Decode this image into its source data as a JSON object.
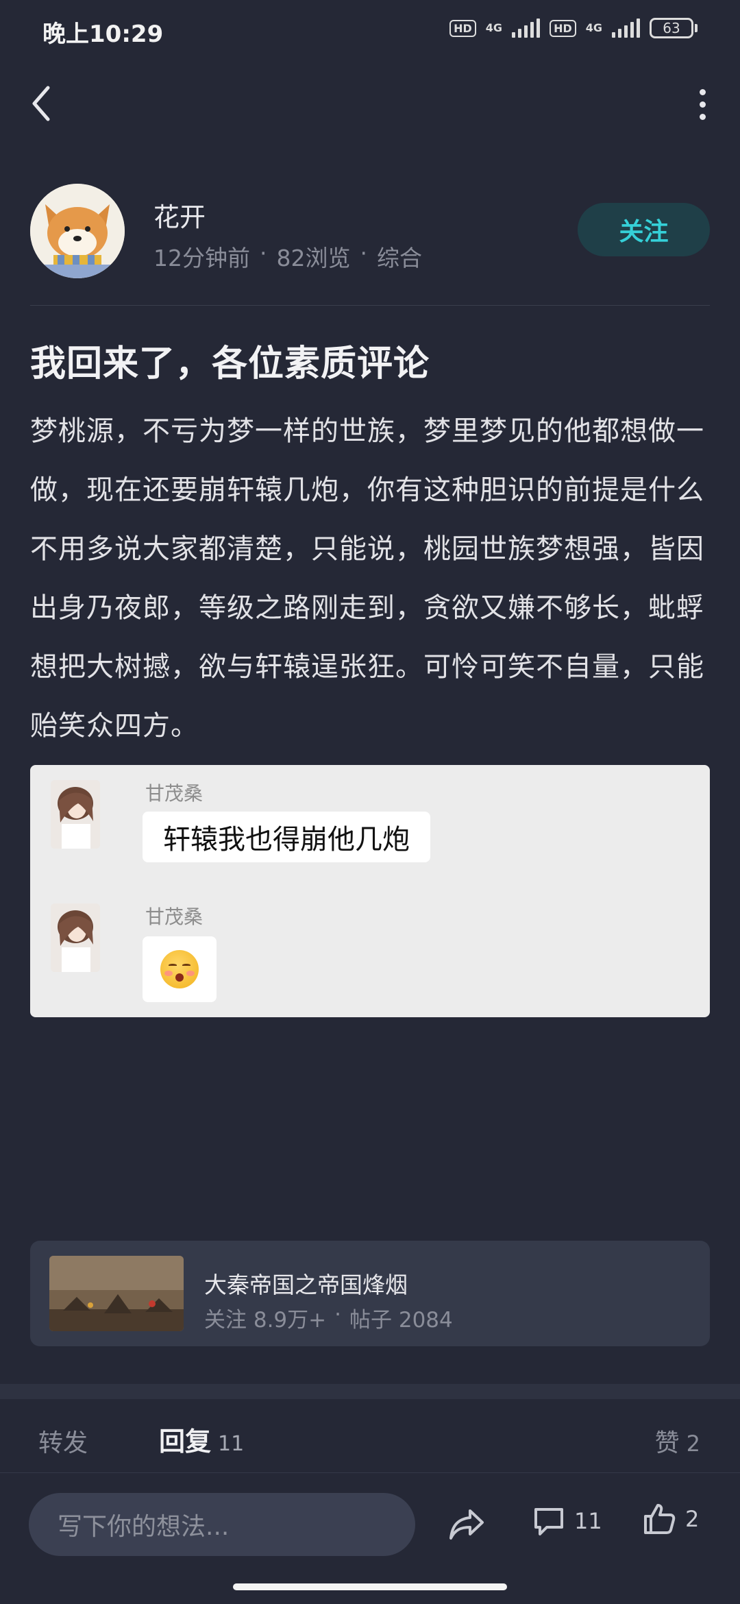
{
  "status_bar": {
    "time": "晚上10:29",
    "hd_label": "HD",
    "network_label": "4G",
    "battery": "63"
  },
  "nav": {
    "back_icon": "chevron-left-icon",
    "more_icon": "more-vertical-icon"
  },
  "author": {
    "name": "花开",
    "time_ago": "12分钟前",
    "views": "82浏览",
    "category": "综合",
    "separator": "·",
    "follow_label": "关注"
  },
  "post": {
    "title": "我回来了，各位素质评论",
    "body": "梦桃源，不亏为梦一样的世族，梦里梦见的他都想做一做，现在还要崩轩辕几炮，你有这种胆识的前提是什么不用多说大家都清楚，只能说，桃园世族梦想强，皆因出身乃夜郎，等级之路刚走到，贪欲又嫌不够长，蚍蜉想把大树撼，欲与轩辕逞张狂。可怜可笑不自量，只能贻笑众四方。"
  },
  "embedded_chat": {
    "messages": [
      {
        "sender": "甘茂桑",
        "text": "轩辕我也得崩他几炮"
      },
      {
        "sender": "甘茂桑",
        "emoji": "flushed-kiss-emoji"
      }
    ]
  },
  "topic": {
    "name": "大秦帝国之帝国烽烟",
    "followers": "关注 8.9万+",
    "separator": "·",
    "posts": "帖子 2084"
  },
  "tabs": {
    "forward_label": "转发",
    "reply_label": "回复",
    "reply_count": "11",
    "like_label": "赞",
    "like_count": "2"
  },
  "bottom_bar": {
    "input_placeholder": "写下你的想法...",
    "comment_count": "11",
    "like_count": "2"
  },
  "colors": {
    "background": "#252836",
    "accent": "#35d0d8",
    "card": "#353a4a"
  }
}
